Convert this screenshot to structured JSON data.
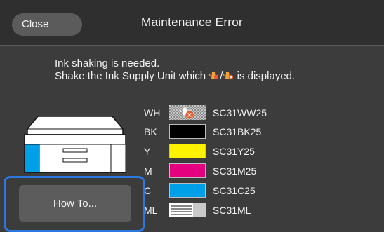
{
  "header": {
    "close_label": "Close",
    "title": "Maintenance Error"
  },
  "message": {
    "line1": "Ink shaking is needed.",
    "line2_before": "Shake the Ink Supply Unit which ",
    "line2_sep": "/",
    "line2_after": " is displayed."
  },
  "inks": [
    {
      "code": "WH",
      "name": "SC31WW25",
      "swatch": "#bfbfbf",
      "icon": "shake-warning-icon"
    },
    {
      "code": "BK",
      "name": "SC31BK25",
      "swatch": "#000000"
    },
    {
      "code": "Y",
      "name": "SC31Y25",
      "swatch": "#fff200"
    },
    {
      "code": "M",
      "name": "SC31M25",
      "swatch": "#e4007f"
    },
    {
      "code": "C",
      "name": "SC31C25",
      "swatch": "#00a0e9"
    },
    {
      "code": "ML",
      "name": "SC31ML",
      "swatch": "#ffffff"
    }
  ],
  "how_to_label": "How To...",
  "colors": {
    "accent": "#2d78e0",
    "background": "#3c3c3c",
    "header": "#2f2f2f",
    "alert": "#e85a2a"
  }
}
